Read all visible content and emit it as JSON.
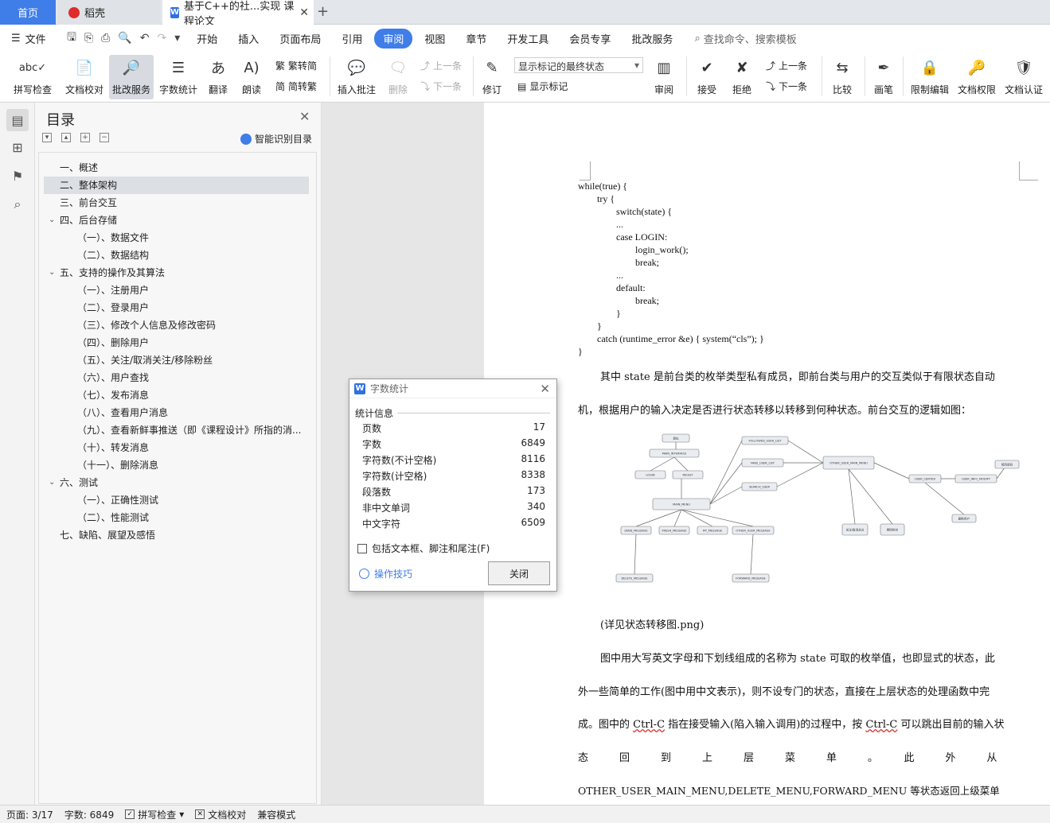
{
  "tabs": {
    "home": "首页",
    "daoke": "稻壳",
    "doc": "基于C++的社...实现 课程论文",
    "add": "+",
    "close": "✕"
  },
  "menu": {
    "file": "文件",
    "items": [
      "开始",
      "插入",
      "页面布局",
      "引用",
      "审阅",
      "视图",
      "章节",
      "开发工具",
      "会员专享",
      "批改服务"
    ],
    "active": "审阅",
    "search": "查找命令、搜索模板"
  },
  "ribbon": {
    "spell": "拼写检查",
    "doc_check": "文档校对",
    "correct_service": "批改服务",
    "word_count": "字数统计",
    "translate": "翻译",
    "read_aloud": "朗读",
    "trad_to_simp": "繁转简",
    "simp_to_trad": "简转繁",
    "insert_comment": "插入批注",
    "delete": "删除",
    "prev": "上一条",
    "next": "下一条",
    "revise": "修订",
    "display_option": "显示标记的最终状态",
    "show_markup": "显示标记",
    "review": "审阅",
    "accept": "接受",
    "reject": "拒绝",
    "prev2": "上一条",
    "next2": "下一条",
    "compare": "比较",
    "pen": "画笔",
    "restrict": "限制编辑",
    "permission": "文档权限",
    "certify": "文档认证"
  },
  "toc": {
    "title": "目录",
    "smart": "智能识别目录",
    "items": [
      {
        "label": "一、概述",
        "level": 1,
        "chev": ""
      },
      {
        "label": "二、整体架构",
        "level": 1,
        "chev": "",
        "selected": true
      },
      {
        "label": "三、前台交互",
        "level": 1,
        "chev": ""
      },
      {
        "label": "四、后台存储",
        "level": 1,
        "chev": "v"
      },
      {
        "label": "（一）、数据文件",
        "level": 2,
        "chev": ""
      },
      {
        "label": "（二）、数据结构",
        "level": 2,
        "chev": ""
      },
      {
        "label": "五、支持的操作及其算法",
        "level": 1,
        "chev": "v"
      },
      {
        "label": "（一）、注册用户",
        "level": 2,
        "chev": ""
      },
      {
        "label": "（二）、登录用户",
        "level": 2,
        "chev": ""
      },
      {
        "label": "（三）、修改个人信息及修改密码",
        "level": 2,
        "chev": ""
      },
      {
        "label": "（四）、删除用户",
        "level": 2,
        "chev": ""
      },
      {
        "label": "（五）、关注/取消关注/移除粉丝",
        "level": 2,
        "chev": ""
      },
      {
        "label": "（六）、用户查找",
        "level": 2,
        "chev": ""
      },
      {
        "label": "（七）、发布消息",
        "level": 2,
        "chev": ""
      },
      {
        "label": "（八）、查看用户消息",
        "level": 2,
        "chev": ""
      },
      {
        "label": "（九）、查看新鲜事推送（即《课程设计》所指的消...",
        "level": 2,
        "chev": ""
      },
      {
        "label": "（十）、转发消息",
        "level": 2,
        "chev": ""
      },
      {
        "label": "（十一）、删除消息",
        "level": 2,
        "chev": ""
      },
      {
        "label": "六、测试",
        "level": 1,
        "chev": "v"
      },
      {
        "label": "（一）、正确性测试",
        "level": 2,
        "chev": ""
      },
      {
        "label": "（二）、性能测试",
        "level": 2,
        "chev": ""
      },
      {
        "label": "七、缺陷、展望及感悟",
        "level": 1,
        "chev": ""
      }
    ]
  },
  "document": {
    "code": "while(true) {\n        try {\n                switch(state) {\n                ...\n                case LOGIN:\n                        login_work();\n                        break;\n                ...\n                default:\n                        break;\n                }\n        }\n        catch (runtime_error &e) { system(“cls”); }\n}",
    "p1_line1": "其中 state 是前台类的枚举类型私有成员，即前台类与用户的交互类似于有限状态自动",
    "p1_line2": "机，根据用户的输入决定是否进行状态转移以转移到何种状态。前台交互的逻辑如图：",
    "caption": "(详见状态转移图.png)",
    "p2_line1": "图中用大写英文字母和下划线组成的名称为 state 可取的枚举值，也即显式的状态，此",
    "p2_line2": "外一些简单的工作(图中用中文表示)，则不设专门的状态，直接在上层状态的处理函数中完",
    "p2_line3a": "成。图中的 ",
    "p2_ctrl1": "Ctrl-C",
    "p2_line3b": " 指在接受输入(陷入输入调用)的过程中，按 ",
    "p2_ctrl2": "Ctrl-C",
    "p2_line3c": " 可以跳出目前的输入状",
    "p2_line4": "态　　　回　　　到　　　上　　　层　　　菜　　　单　　　。　　　此　　　外　　　从",
    "p2_line5": "OTHER_USER_MAIN_MENU,DELETE_MENU,FORWARD_MENU 等状态返回上级菜单",
    "diagram_nodes": [
      "退出",
      "MAIN_INTERFACE",
      "LOGIN",
      "REGIST",
      "MAIN_MENU",
      "FOLLOWED_USER_LIST",
      "FANS_USER_LIST",
      "SEARCH_USER",
      "OTHER_USER_MAIN_MENU",
      "USER_CENTER",
      "USER_INFO_MODIFY",
      "SEND_MESSAGE",
      "FRESH_MESSAGE",
      "MY_MESSAGE",
      "OTHER_USER_MESSAGE",
      "DELETE_MESSAGE",
      "FORWARD_MESSAGE",
      "关注/取消关注",
      "移除粉丝",
      "删除用户",
      "修改密码"
    ]
  },
  "dialog": {
    "title": "字数统计",
    "group": "统计信息",
    "stats": [
      {
        "label": "页数",
        "value": "17"
      },
      {
        "label": "字数",
        "value": "6849"
      },
      {
        "label": "字符数(不计空格)",
        "value": "8116"
      },
      {
        "label": "字符数(计空格)",
        "value": "8338"
      },
      {
        "label": "段落数",
        "value": "173"
      },
      {
        "label": "非中文单词",
        "value": "340"
      },
      {
        "label": "中文字符",
        "value": "6509"
      }
    ],
    "checkbox": "包括文本框、脚注和尾注(F)",
    "tips": "操作技巧",
    "close": "关闭"
  },
  "status": {
    "page": "页面: 3/17",
    "words": "字数: 6849",
    "spell": "拼写检查",
    "check": "文档校对",
    "compat": "兼容模式"
  },
  "colors": {
    "accent": "#3f7de8",
    "spell_error": "#dd3333"
  }
}
